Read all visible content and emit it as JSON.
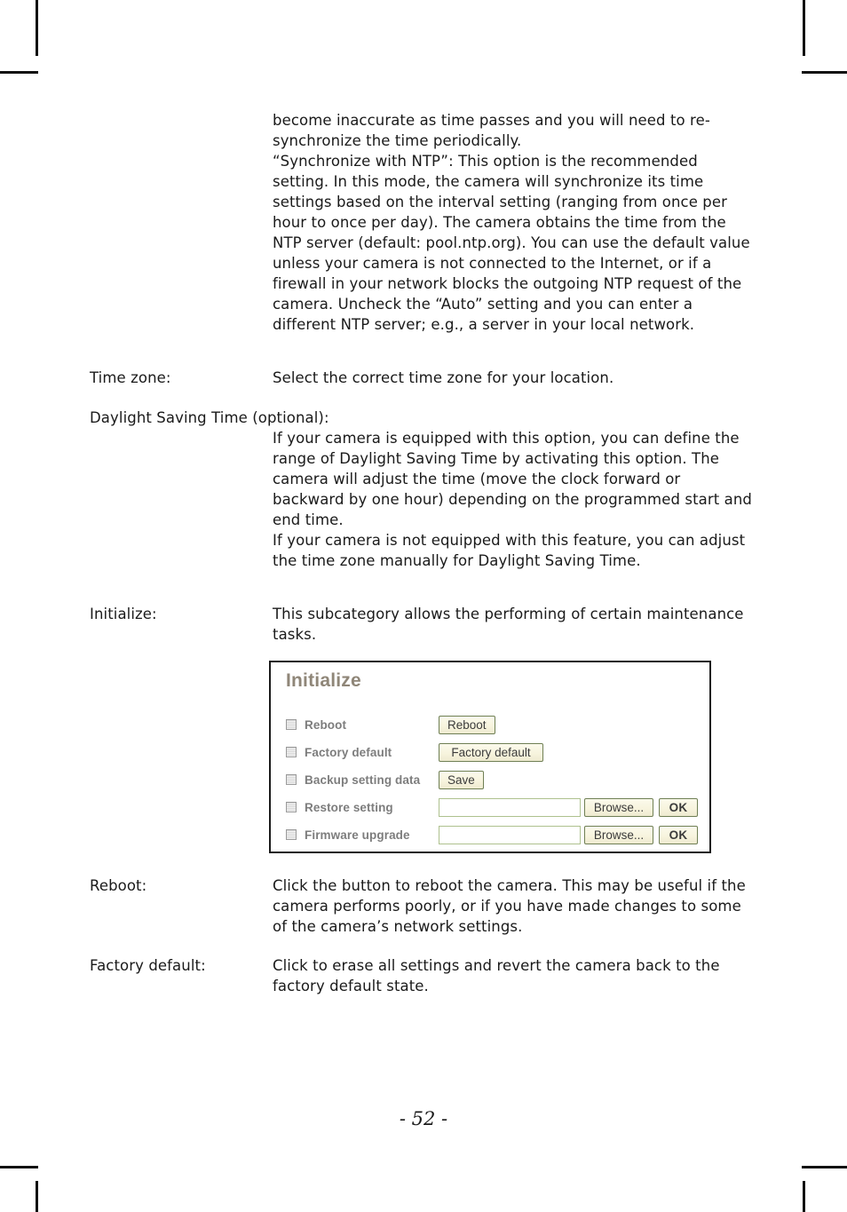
{
  "page": {
    "number_label": "- 52 -"
  },
  "sections": [
    {
      "label": "",
      "body": [
        "become inaccurate as time passes and you will need to re-synchronize the time periodically.",
        "“Synchronize with NTP”: This option is the recommended setting. In this mode, the camera will synchronize its time settings based on the interval setting (ranging from once per hour to once per day). The camera obtains the time from the NTP server (default: pool.ntp.org). You can use the default value unless your camera is not connected to the Internet, or if a firewall in your network blocks the outgoing NTP request of the camera. Uncheck the “Auto” setting and you can enter a different NTP server; e.g., a server in your local network."
      ]
    },
    {
      "label": "Time zone:",
      "body": [
        "Select the correct time zone for your location."
      ]
    },
    {
      "label": "Daylight Saving Time (optional):",
      "body": [
        "If your camera is equipped with this option, you can define the range of Daylight Saving Time by activating this option. The camera will adjust the time (move the clock forward or backward by one hour) depending on the programmed start and end time.",
        "If your camera is not equipped with this feature, you can adjust the time zone manually for Daylight Saving Time."
      ]
    },
    {
      "label": "Initialize:",
      "body": [
        "This subcategory allows the performing of certain maintenance tasks."
      ]
    },
    {
      "label": "Reboot:",
      "body": [
        "Click the button to reboot the camera. This may be useful if the camera performs poorly, or if you have made changes to some of the camera’s network settings."
      ]
    },
    {
      "label": "Factory default:",
      "body": [
        "Click to erase all settings and revert the camera back to the factory default state."
      ]
    }
  ],
  "initialize_panel": {
    "title": "Initialize",
    "colors": {
      "title": "#8f8678",
      "label": "#7d7d7d",
      "button_border": "#6f7f54",
      "button_face": "#f7f4de",
      "input_border": "#aec18e",
      "panel_border": "#1b1b1b"
    },
    "rows": [
      {
        "bullet": "list-square-icon",
        "label": "Reboot",
        "controls": [
          {
            "kind": "button",
            "text": "Reboot",
            "style": "btn-reboot"
          }
        ]
      },
      {
        "bullet": "list-square-icon",
        "label": "Factory default",
        "controls": [
          {
            "kind": "button",
            "text": "Factory default",
            "style": "btn-factory"
          }
        ]
      },
      {
        "bullet": "list-square-icon",
        "label": "Backup setting data",
        "controls": [
          {
            "kind": "button",
            "text": "Save",
            "style": "btn-save"
          }
        ]
      },
      {
        "bullet": "list-square-icon",
        "label": "Restore setting",
        "controls": [
          {
            "kind": "input",
            "value": "",
            "placeholder": ""
          },
          {
            "kind": "button",
            "text": "Browse...",
            "style": "btn-browse"
          },
          {
            "kind": "button",
            "text": "OK",
            "style": "btn-ok"
          }
        ]
      },
      {
        "bullet": "list-square-icon",
        "label": "Firmware upgrade",
        "controls": [
          {
            "kind": "input",
            "value": "",
            "placeholder": ""
          },
          {
            "kind": "button",
            "text": "Browse...",
            "style": "btn-browse"
          },
          {
            "kind": "button",
            "text": "OK",
            "style": "btn-ok"
          }
        ]
      }
    ]
  }
}
